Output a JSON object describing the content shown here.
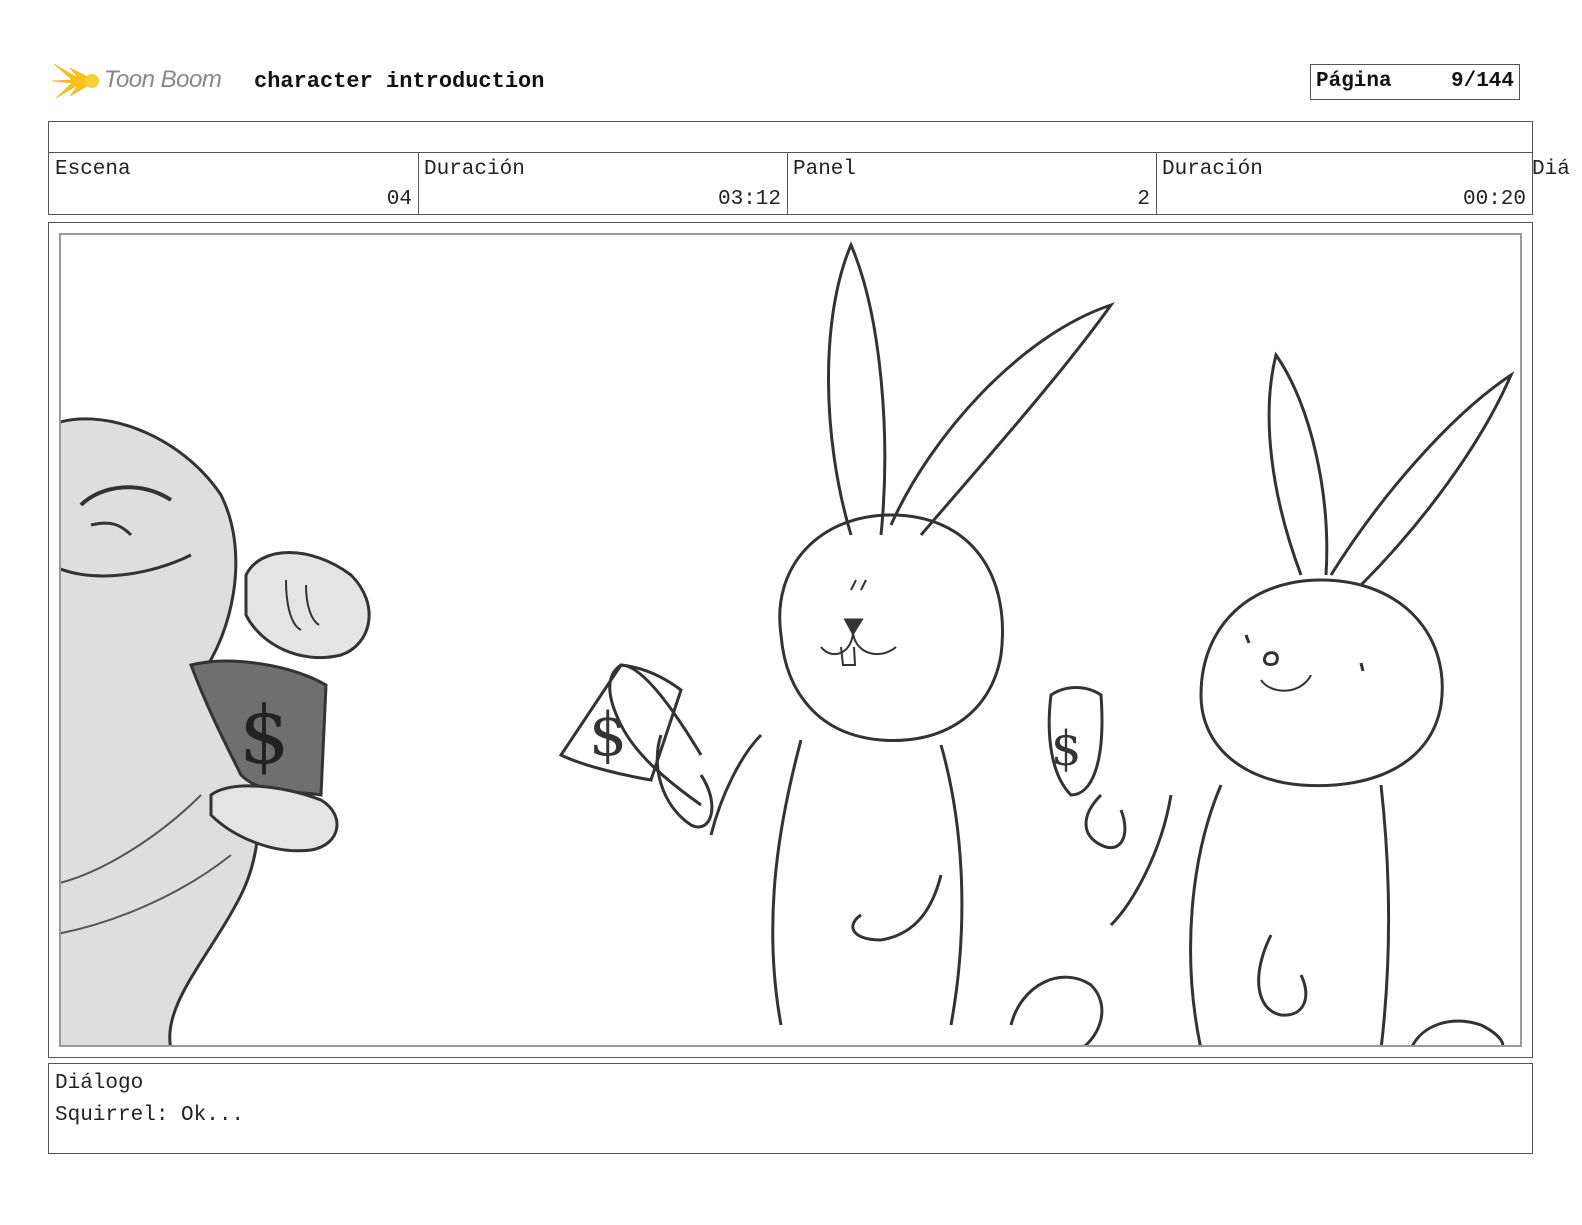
{
  "header": {
    "logo_text": "Toon Boom",
    "title": "character introduction",
    "page_label": "Página",
    "page_number": "9/144"
  },
  "info": {
    "scene_label": "Escena",
    "scene_value": "04",
    "scene_duration_label": "Duración",
    "scene_duration_value": "03:12",
    "panel_label": "Panel",
    "panel_value": "2",
    "panel_duration_label": "Duración",
    "panel_duration_value": "00:20",
    "overflow_label": "Diá"
  },
  "dialog": {
    "label": "Diálogo",
    "text": "Squirrel: Ok..."
  },
  "panel": {
    "money_symbol": "$"
  }
}
